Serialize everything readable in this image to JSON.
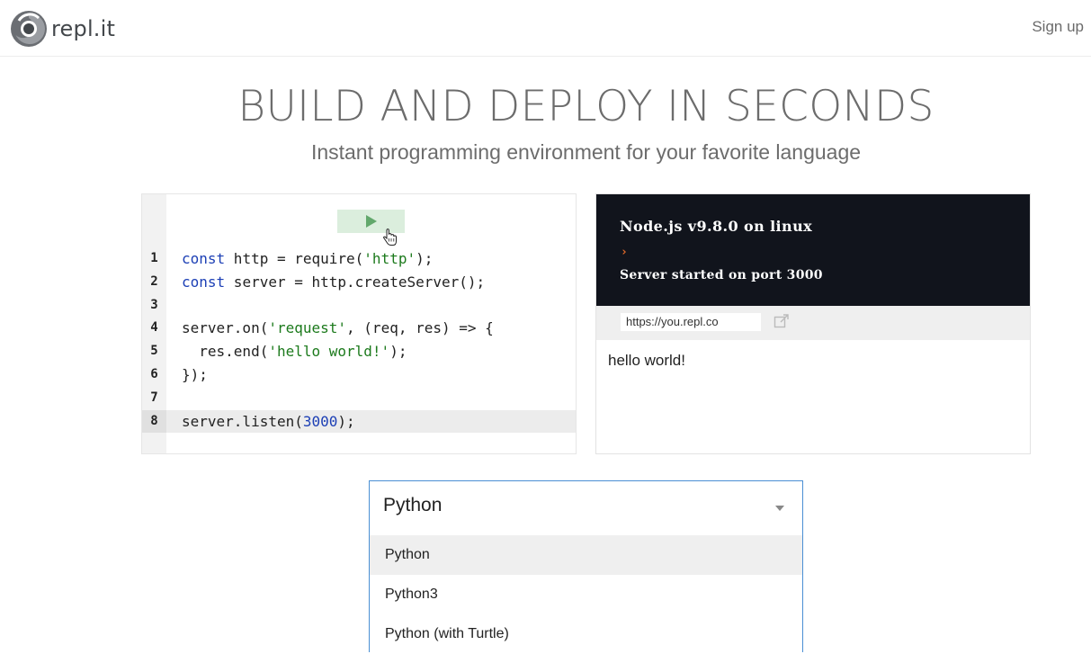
{
  "header": {
    "logo_text": "repl.it",
    "signup_label": "Sign up"
  },
  "hero": {
    "title": "BUILD AND DEPLOY IN SECONDS",
    "subtitle": "Instant programming environment for your favorite language"
  },
  "editor": {
    "run_icon": "play-icon",
    "lines": [
      {
        "n": "1",
        "tokens": [
          [
            "kw",
            "const"
          ],
          [
            "txt",
            " http = require("
          ],
          [
            "str",
            "'http'"
          ],
          [
            "txt",
            ");"
          ]
        ]
      },
      {
        "n": "2",
        "tokens": [
          [
            "kw",
            "const"
          ],
          [
            "txt",
            " server = http.createServer();"
          ]
        ]
      },
      {
        "n": "3",
        "tokens": []
      },
      {
        "n": "4",
        "tokens": [
          [
            "txt",
            "server.on("
          ],
          [
            "str",
            "'request'"
          ],
          [
            "txt",
            ", (req, res) => {"
          ]
        ]
      },
      {
        "n": "5",
        "tokens": [
          [
            "txt",
            "  res.end("
          ],
          [
            "str",
            "'hello world!'"
          ],
          [
            "txt",
            ");"
          ]
        ]
      },
      {
        "n": "6",
        "tokens": [
          [
            "txt",
            "});"
          ]
        ]
      },
      {
        "n": "7",
        "tokens": []
      },
      {
        "n": "8",
        "tokens": [
          [
            "txt",
            "server.listen("
          ],
          [
            "num",
            "3000"
          ],
          [
            "txt",
            ");"
          ]
        ],
        "active": true
      }
    ]
  },
  "output": {
    "console_title": "Node.js v9.8.0 on linux",
    "prompt": "›",
    "console_log": "Server started on port 3000",
    "url": "https://you.repl.co",
    "webview_text": "hello world!"
  },
  "language_select": {
    "selected": "Python",
    "options": [
      "Python",
      "Python3",
      "Python (with Turtle)"
    ],
    "highlighted_index": 0
  },
  "colors": {
    "accent": "#4a8fd4",
    "run_button_bg": "#dbeedd",
    "console_bg": "#11141c"
  }
}
